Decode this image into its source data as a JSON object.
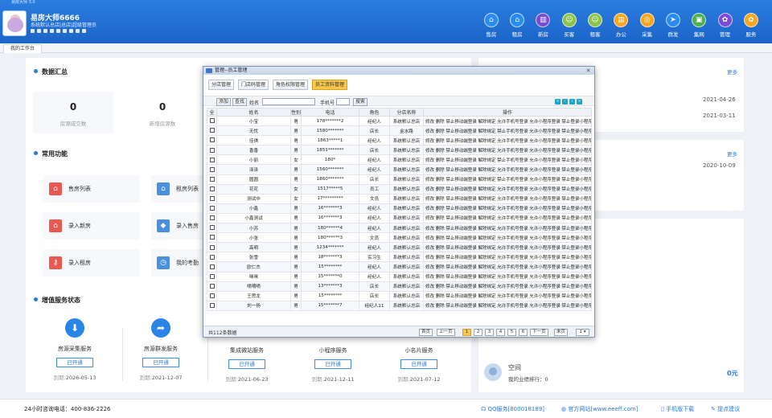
{
  "window": {
    "title": "易房大师 3.0"
  },
  "brand": {
    "name": "易房大师6666",
    "subtitle": "系统默认总店|总店|超级管理员"
  },
  "modules": [
    {
      "label": "售房",
      "icon": "house-icon",
      "color": "#2a8cf0",
      "glyph": "⌂"
    },
    {
      "label": "租房",
      "icon": "key-house-icon",
      "color": "#2a8cf0",
      "glyph": "⌂"
    },
    {
      "label": "新房",
      "icon": "building-icon",
      "color": "#7a4bd6",
      "glyph": "▥"
    },
    {
      "label": "买客",
      "icon": "buyer-icon",
      "color": "#8bc34a",
      "glyph": "☺"
    },
    {
      "label": "租客",
      "icon": "tenant-icon",
      "color": "#8bc34a",
      "glyph": "☺"
    },
    {
      "label": "办公",
      "icon": "briefcase-icon",
      "color": "#f5a623",
      "glyph": "▤"
    },
    {
      "label": "采集",
      "icon": "collect-icon",
      "color": "#f5a623",
      "glyph": "◎"
    },
    {
      "label": "群发",
      "icon": "send-icon",
      "color": "#2a8cf0",
      "glyph": "➤"
    },
    {
      "label": "集网",
      "icon": "network-icon",
      "color": "#4caf50",
      "glyph": "▣"
    },
    {
      "label": "管理",
      "icon": "gear-icon",
      "color": "#7a4bd6",
      "glyph": "✿"
    },
    {
      "label": "服务",
      "icon": "service-icon",
      "color": "#f5a623",
      "glyph": "✿"
    }
  ],
  "tabs": [
    {
      "label": "我的工作台"
    }
  ],
  "summary": {
    "title": "数据汇总",
    "stats": [
      {
        "value": "0",
        "label": "房源成交数"
      },
      {
        "value": "0",
        "label": "新增房源数"
      }
    ]
  },
  "common": {
    "title": "常用功能",
    "items": [
      {
        "label": "售房列表",
        "color": "#e85a50",
        "glyph": "⌂"
      },
      {
        "label": "租房列表",
        "color": "#4a8fe0",
        "glyph": "⌂"
      },
      {
        "label": "录入新房",
        "color": "#e85a50",
        "glyph": "⌂"
      },
      {
        "label": "录入售房",
        "color": "#4a8fe0",
        "glyph": "◆"
      },
      {
        "label": "录入租房",
        "color": "#e85a50",
        "glyph": "⚷"
      },
      {
        "label": "我的考勤",
        "color": "#4a8fe0",
        "glyph": "◷"
      }
    ]
  },
  "services": {
    "title": "增值服务状态",
    "date_prefix": "到期:",
    "items": [
      {
        "name": "房源采集服务",
        "button": "已开通",
        "expiry": "2026-05-13",
        "glyph": "⬇"
      },
      {
        "name": "房源群发服务",
        "button": "已开通",
        "expiry": "2021-12-07",
        "glyph": "➦"
      },
      {
        "name": "集成微站服务",
        "button": "已开通",
        "expiry": "2021-06-23"
      },
      {
        "name": "小程序服务",
        "button": "已开通",
        "expiry": "2021-12-11"
      },
      {
        "name": "小名片服务",
        "button": "已开通",
        "expiry": "2021-07-12"
      }
    ]
  },
  "right": {
    "more1": "更多",
    "dates1": [
      "2021-04-26",
      "2021-03-11"
    ],
    "more2": "更多",
    "dates2": [
      "2020-10-09"
    ],
    "user_name": "空间",
    "user_rank": "我的业绩排行：0",
    "amount": "0元"
  },
  "footer": {
    "hotline": "24小时咨询电话：400-836-2226",
    "links": [
      "QQ服务[800018189]",
      "官方网站[www.eeeff.com]",
      "手机版下载",
      "提点建议"
    ]
  },
  "modal": {
    "title": "管理--员工管理",
    "tabs": [
      "分店管理",
      "门店码管理",
      "角色权限管理",
      "员工资料管理"
    ],
    "toolbar": {
      "add": "添加",
      "search": "查找",
      "name_label": "姓名",
      "phone_label": "手机号",
      "query": "搜索"
    },
    "columns": [
      "全",
      "姓名",
      "性别",
      "电话",
      "角色",
      "分店名称",
      "操作"
    ],
    "ops": "修改 删除 禁止移动端登录 解除绑定 允许手机号登录 允许小程序登录 禁止登录小程序",
    "ops_alt": "修改 删除 禁止移动端登录 解除绑定 禁止手机号登录 允许小程序登录 禁止登录小程序",
    "rows": [
      {
        "name": "小宝",
        "sex": "男",
        "phone": "178*******2",
        "role": "经纪人",
        "branch": "系统默认总店"
      },
      {
        "name": "无忧",
        "sex": "男",
        "phone": "1580*******",
        "role": "店长",
        "branch": "金水路"
      },
      {
        "name": "佳琪",
        "sex": "男",
        "phone": "1863*****1",
        "role": "经纪人",
        "branch": "系统默认总店"
      },
      {
        "name": "香香",
        "sex": "男",
        "phone": "1851*******",
        "role": "店长",
        "branch": "系统默认总店"
      },
      {
        "name": "小丽",
        "sex": "女",
        "phone": "180*",
        "role": "经纪人",
        "branch": "系统默认总店"
      },
      {
        "name": "泽泽",
        "sex": "男",
        "phone": "1560*******",
        "role": "经纪人",
        "branch": "系统默认总店"
      },
      {
        "name": "圆圆",
        "sex": "男",
        "phone": "1860*******",
        "role": "店长",
        "branch": "系统默认总店"
      },
      {
        "name": "花花",
        "sex": "女",
        "phone": "1517*****5",
        "role": "员工",
        "branch": "系统默认总店"
      },
      {
        "name": "测试中",
        "sex": "女",
        "phone": "17*********",
        "role": "文员",
        "branch": "系统默认总店"
      },
      {
        "name": "小鑫",
        "sex": "男",
        "phone": "16*******3",
        "role": "经纪人",
        "branch": "系统默认总店"
      },
      {
        "name": "小鑫测试",
        "sex": "男",
        "phone": "16*******3",
        "role": "经纪人",
        "branch": "系统默认总店"
      },
      {
        "name": "小苏",
        "sex": "男",
        "phone": "180******4",
        "role": "经纪人",
        "branch": "系统默认总店"
      },
      {
        "name": "小张",
        "sex": "男",
        "phone": "180******3",
        "role": "文员",
        "branch": "系统默认总店"
      },
      {
        "name": "高明",
        "sex": "男",
        "phone": "1234*******",
        "role": "经纪人",
        "branch": "系统默认总店"
      },
      {
        "name": "张雪",
        "sex": "男",
        "phone": "18*******3",
        "role": "实习生",
        "branch": "系统默认总店"
      },
      {
        "name": "欧仁杰",
        "sex": "男",
        "phone": "15********",
        "role": "经纪人",
        "branch": "系统默认总店"
      },
      {
        "name": "咪咪",
        "sex": "男",
        "phone": "15*******0",
        "role": "经纪人",
        "branch": "系统默认总店"
      },
      {
        "name": "嘀嘀嘀",
        "sex": "男",
        "phone": "13*******3",
        "role": "店长",
        "branch": "系统默认总店"
      },
      {
        "name": "王思龙",
        "sex": "男",
        "phone": "15********",
        "role": "店长",
        "branch": "系统默认总店"
      },
      {
        "name": "刘一扬",
        "sex": "男",
        "phone": "15*******7",
        "role": "经纪人11",
        "branch": "系统默认总店"
      }
    ],
    "total": "共112条数据",
    "pager": {
      "first": "首页",
      "prev": "上一页",
      "pages": [
        "1",
        "2",
        "3",
        "4",
        "5",
        "6"
      ],
      "next": "下一页",
      "last": "末页",
      "select": "1"
    }
  }
}
